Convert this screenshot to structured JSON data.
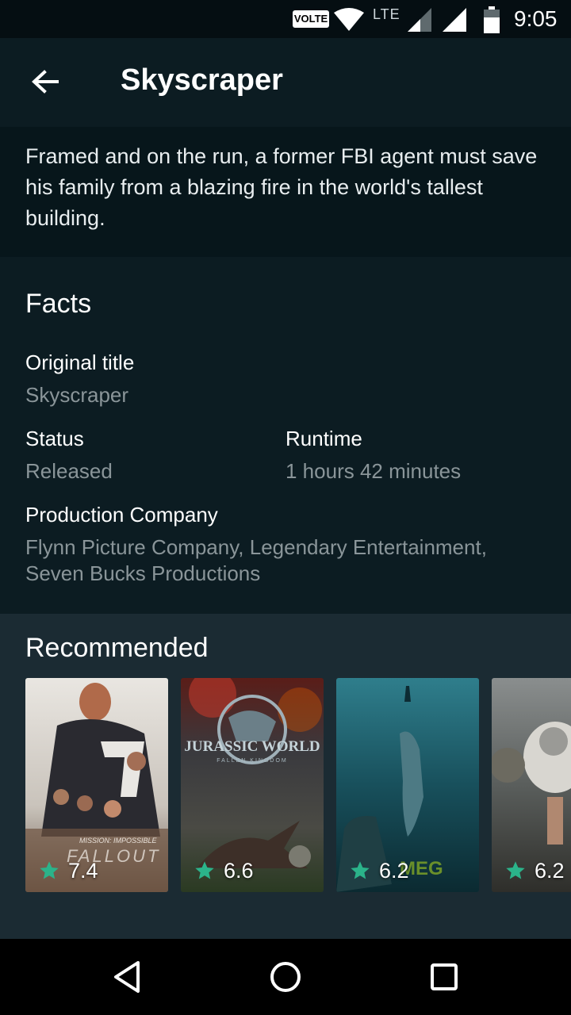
{
  "status_bar": {
    "volte": "VOLTE",
    "network": "LTE",
    "time": "9:05",
    "icons": [
      "wifi-icon",
      "signal-icon",
      "signal-icon",
      "battery-icon"
    ]
  },
  "toolbar": {
    "title": "Skyscraper",
    "back_icon": "arrow-back-icon"
  },
  "overview": "Framed and on the run, a former FBI agent must save his family from a blazing fire in the world's tallest building.",
  "facts": {
    "heading": "Facts",
    "original_title_label": "Original title",
    "original_title": "Skyscraper",
    "status_label": "Status",
    "status": "Released",
    "runtime_label": "Runtime",
    "runtime": "1 hours 42 minutes",
    "production_label": "Production Company",
    "production": "Flynn Picture Company, Legendary Entertainment, Seven Bucks Productions"
  },
  "recommended": {
    "heading": "Recommended",
    "items": [
      {
        "rating": "7.4",
        "poster_text": "MISSION: IMPOSSIBLE",
        "poster_sub": "FALLOUT"
      },
      {
        "rating": "6.6",
        "poster_text": "JURASSIC WORLD",
        "poster_sub": "FALLEN KINGDOM"
      },
      {
        "rating": "6.2",
        "poster_text": "MEG"
      },
      {
        "rating": "6.2"
      }
    ]
  },
  "nav": {
    "icons": [
      "back-triangle-icon",
      "home-circle-icon",
      "recents-square-icon"
    ]
  },
  "colors": {
    "accent_star": "#2bb38a",
    "background": "#0c1c22",
    "recommended_bg": "#1b2b33"
  }
}
